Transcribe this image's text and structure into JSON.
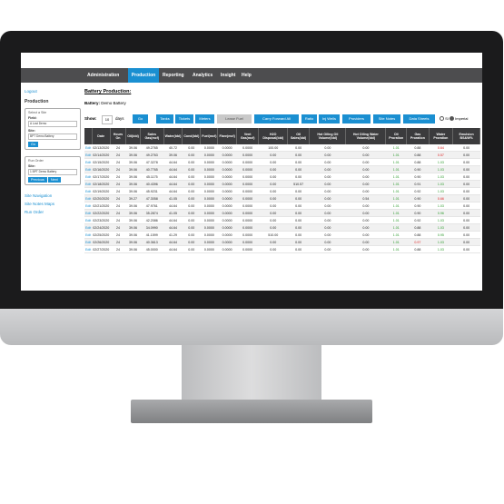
{
  "nav": {
    "items": [
      "Administration",
      "Production",
      "Reporting",
      "Analytics",
      "Insight",
      "Help"
    ],
    "active": "Production"
  },
  "sidebar": {
    "logout": "Logout",
    "heading": "Production",
    "select_site": {
      "legend": "Select a Site",
      "field_label": "Field:",
      "field_value": "A Lost Demo",
      "site_label": "Site:",
      "site_value": "BPT Demo Battery",
      "go": "Go"
    },
    "run_order": {
      "legend": "Run Order",
      "site_label": "Site:",
      "site_value": "1 BPT Demo Battery",
      "previous": "Previous",
      "next": "Next"
    },
    "links": [
      "Site Navigation",
      "Site Notes Maps",
      "Run Order"
    ]
  },
  "main": {
    "title": "Battery Production:",
    "battery_label": "Battery:",
    "battery_name": "Demo Battery",
    "show_label": "Show:",
    "days_value": "10",
    "days_label": "days",
    "go": "Go",
    "buttons": [
      "Tanks",
      "Tickets",
      "Meters",
      "Lease Fuel",
      "Carry Forward All",
      "Ratio",
      "Inj Wells",
      "Providers",
      "Site Notes",
      "Data Sheets"
    ],
    "units": [
      "SI",
      "Imperial"
    ],
    "units_selected": "Imperial"
  },
  "table": {
    "headers": [
      "",
      "Date",
      "Hours On",
      "Oil(bbl)",
      "Sales Gas(mcf)",
      "Water(bbl)",
      "Cond(bbl)",
      "Fuel(mcf)",
      "Flare(mcf)",
      "Vent Gas(mcf)",
      "H2O Disposal(bbl)",
      "Oil Sales(bbl)",
      "Hot Oiling Oil Volume(bbl)",
      "Hot Oiling Water Volume(bbl)",
      "Oil Proration",
      "Gas Proration",
      "Water Proration",
      "Emulsion BS&W%"
    ],
    "rows": [
      [
        "Edit",
        "02/13/2020",
        "24",
        "39.06",
        "49.2765",
        "40.72",
        "0.00",
        "0.0000",
        "0.0000",
        "0.0000",
        "100.00",
        "0.00",
        "0.00",
        "0.00",
        "1.01",
        "0.88",
        "0.64",
        "0.00"
      ],
      [
        "Edit",
        "02/14/2020",
        "24",
        "39.06",
        "49.2763",
        "39.06",
        "0.00",
        "0.0000",
        "0.0000",
        "0.0000",
        "0.00",
        "0.00",
        "0.00",
        "0.00",
        "1.01",
        "0.88",
        "0.57",
        "0.00"
      ],
      [
        "Edit",
        "02/15/2020",
        "24",
        "39.06",
        "47.3278",
        "44.64",
        "0.00",
        "0.0000",
        "0.0000",
        "0.0000",
        "0.00",
        "0.00",
        "0.00",
        "0.00",
        "1.01",
        "0.88",
        "1.03",
        "0.00"
      ],
      [
        "Edit",
        "02/16/2020",
        "24",
        "39.06",
        "40.7765",
        "44.64",
        "0.00",
        "0.0000",
        "0.0000",
        "0.0000",
        "0.00",
        "0.00",
        "0.00",
        "0.00",
        "1.01",
        "0.90",
        "1.03",
        "0.00"
      ],
      [
        "Edit",
        "02/17/2020",
        "24",
        "39.06",
        "45.1175",
        "44.64",
        "0.00",
        "0.0000",
        "0.0000",
        "0.0000",
        "0.00",
        "0.00",
        "0.00",
        "0.00",
        "1.01",
        "0.90",
        "1.03",
        "0.00"
      ],
      [
        "Edit",
        "02/18/2020",
        "24",
        "39.06",
        "40.4396",
        "44.64",
        "0.00",
        "0.0000",
        "0.0000",
        "0.0000",
        "0.00",
        "510.57",
        "0.00",
        "0.00",
        "1.01",
        "0.91",
        "1.03",
        "0.00"
      ],
      [
        "Edit",
        "02/19/2020",
        "24",
        "39.06",
        "45.9231",
        "44.64",
        "0.00",
        "0.0000",
        "0.0000",
        "0.0000",
        "0.00",
        "0.00",
        "0.00",
        "0.00",
        "1.01",
        "0.92",
        "1.03",
        "0.00"
      ],
      [
        "Edit",
        "02/20/2020",
        "24",
        "39.27",
        "47.3058",
        "41.05",
        "0.00",
        "0.0000",
        "0.0000",
        "0.0000",
        "0.00",
        "0.00",
        "0.00",
        "0.54",
        "1.01",
        "0.90",
        "0.66",
        "0.00"
      ],
      [
        "Edit",
        "02/21/2020",
        "24",
        "39.06",
        "47.9761",
        "44.64",
        "0.00",
        "0.0000",
        "0.0000",
        "0.0000",
        "0.00",
        "0.00",
        "0.00",
        "0.00",
        "1.01",
        "0.90",
        "1.03",
        "0.00"
      ],
      [
        "Edit",
        "02/22/2020",
        "24",
        "39.06",
        "35.2874",
        "41.05",
        "0.00",
        "0.0000",
        "0.0000",
        "0.0000",
        "0.00",
        "0.00",
        "0.00",
        "0.00",
        "1.01",
        "0.90",
        "0.96",
        "0.00"
      ],
      [
        "Edit",
        "02/23/2020",
        "24",
        "39.06",
        "42.2086",
        "44.64",
        "0.00",
        "0.0000",
        "0.0000",
        "0.0000",
        "0.00",
        "0.00",
        "0.00",
        "0.00",
        "1.01",
        "0.92",
        "1.03",
        "0.00"
      ],
      [
        "Edit",
        "02/24/2020",
        "24",
        "39.06",
        "34.0990",
        "44.64",
        "0.00",
        "0.0000",
        "0.0000",
        "0.0000",
        "0.00",
        "0.00",
        "0.00",
        "0.00",
        "1.01",
        "0.88",
        "1.03",
        "0.00"
      ],
      [
        "Edit",
        "02/25/2020",
        "24",
        "39.06",
        "41.1599",
        "41.29",
        "0.00",
        "0.0000",
        "0.0000",
        "0.0000",
        "510.00",
        "0.00",
        "0.00",
        "0.00",
        "1.01",
        "0.88",
        "0.95",
        "0.00"
      ],
      [
        "Edit",
        "02/26/2020",
        "24",
        "39.06",
        "40.3613",
        "44.64",
        "0.00",
        "0.0000",
        "0.0000",
        "0.0000",
        "0.00",
        "0.00",
        "0.00",
        "0.00",
        "1.01",
        "0.97",
        "1.03",
        "0.00"
      ],
      [
        "Edit",
        "02/27/2020",
        "24",
        "39.06",
        "45.0000",
        "44.64",
        "0.00",
        "0.0000",
        "0.0000",
        "0.0000",
        "0.00",
        "0.00",
        "0.00",
        "0.00",
        "1.01",
        "0.88",
        "1.03",
        "0.00"
      ]
    ]
  }
}
